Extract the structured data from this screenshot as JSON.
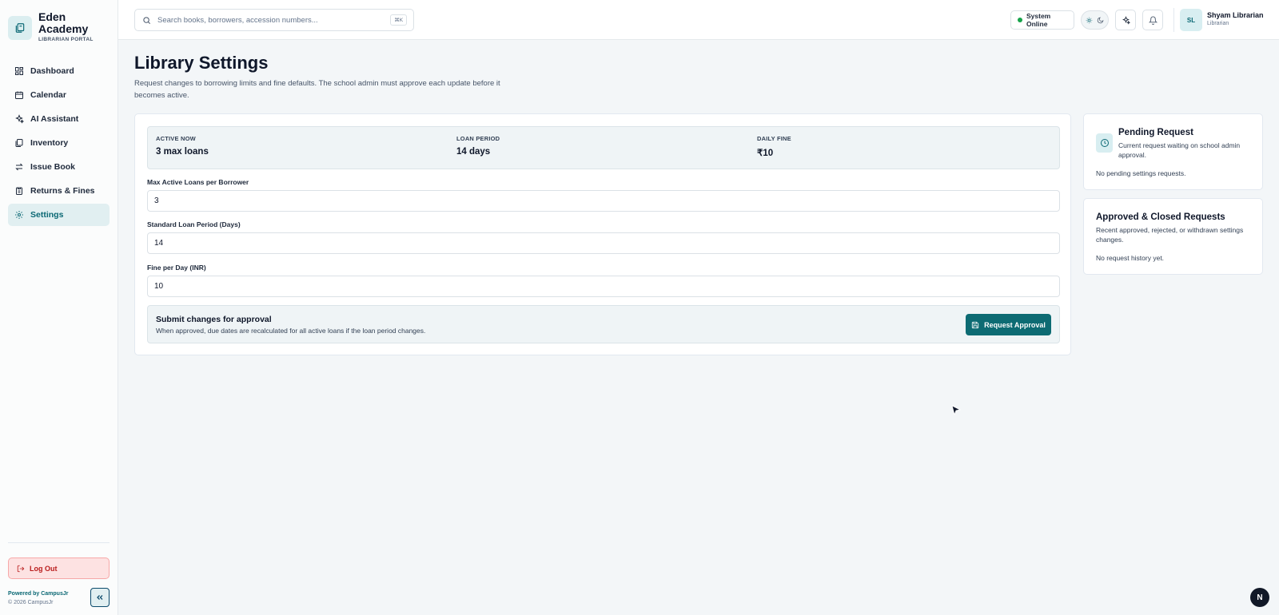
{
  "brand": {
    "name": "Eden Academy",
    "subtitle": "LIBRARIAN PORTAL",
    "logo_icon": "library-books-icon"
  },
  "sidebar": {
    "items": [
      {
        "label": "Dashboard",
        "icon": "dashboard-grid-icon",
        "active": false
      },
      {
        "label": "Calendar",
        "icon": "calendar-icon",
        "active": false
      },
      {
        "label": "AI Assistant",
        "icon": "sparkles-icon",
        "active": false
      },
      {
        "label": "Inventory",
        "icon": "books-stack-icon",
        "active": false
      },
      {
        "label": "Issue Book",
        "icon": "swap-arrows-icon",
        "active": false
      },
      {
        "label": "Returns & Fines",
        "icon": "clipboard-icon",
        "active": false
      },
      {
        "label": "Settings",
        "icon": "gear-icon",
        "active": true
      }
    ],
    "logout_label": "Log Out",
    "powered_by": "Powered by CampusJr",
    "copyright": "© 2026 CampusJr"
  },
  "topbar": {
    "search_placeholder": "Search books, borrowers, accession numbers...",
    "search_shortcut": "⌘K",
    "status_label": "System Online",
    "user": {
      "initials": "SL",
      "name": "Shyam Librarian",
      "role": "Librarian"
    }
  },
  "page": {
    "title": "Library Settings",
    "description": "Request changes to borrowing limits and fine defaults. The school admin must approve each update before it becomes active."
  },
  "summary": [
    {
      "label": "ACTIVE NOW",
      "value": "3 max loans"
    },
    {
      "label": "LOAN PERIOD",
      "value": "14 days"
    },
    {
      "label": "DAILY FINE",
      "value": "₹10"
    }
  ],
  "form": {
    "max_loans": {
      "label": "Max Active Loans per Borrower",
      "value": "3"
    },
    "loan_period": {
      "label": "Standard Loan Period (Days)",
      "value": "14"
    },
    "fine": {
      "label": "Fine per Day (INR)",
      "value": "10"
    }
  },
  "submit": {
    "title": "Submit changes for approval",
    "description": "When approved, due dates are recalculated for all active loans if the loan period changes.",
    "button_label": "Request Approval"
  },
  "pending": {
    "title": "Pending Request",
    "description": "Current request waiting on school admin approval.",
    "empty": "No pending settings requests."
  },
  "history": {
    "title": "Approved & Closed Requests",
    "description": "Recent approved, rejected, or withdrawn settings changes.",
    "empty": "No request history yet."
  },
  "misc": {
    "n_badge": "N"
  },
  "colors": {
    "accent": "#0d6b73",
    "active_bg": "#e1eff1",
    "logout_bg": "#fde2e2",
    "status_green": "#16a34a"
  }
}
